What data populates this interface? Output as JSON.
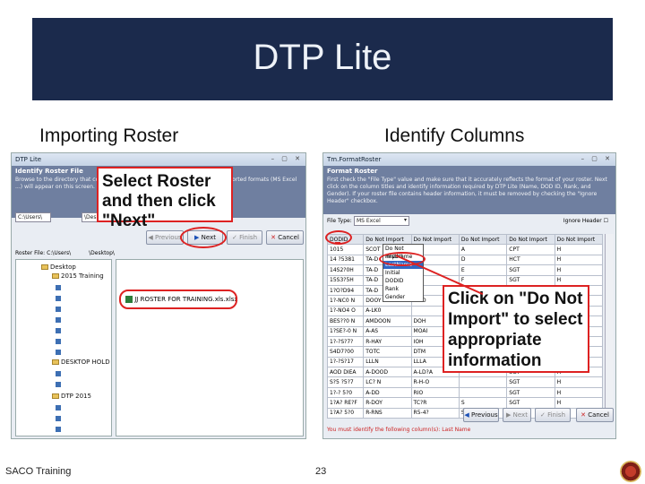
{
  "slide": {
    "title": "DTP Lite",
    "left_heading": "Importing Roster",
    "right_heading": "Identify Columns",
    "footer_left": "SACO Training",
    "page_number": "23"
  },
  "left_window": {
    "window_title": "DTP Lite",
    "pane_title": "Identify Roster File",
    "pane_desc": "Browse to the directory that contains the roster file. Only files in one of the supported formats (MS Excel ...) will appear on this screen.",
    "path_value": "C:\\Users\\",
    "path_value2": "\\Desktop\\",
    "buttons": {
      "previous": "Previous",
      "next": "Next",
      "finish": "Finish",
      "cancel": "Cancel"
    },
    "roster_file_label": "Roster File: C:\\Users\\",
    "roster_file_label2": "\\Desktop\\",
    "tree": {
      "items": [
        "Desktop",
        "2015 Training",
        "DESKTOP HOLD",
        "DTP 2015"
      ]
    },
    "selected_file": "JJ ROSTER FOR TRAINING.xls.xlsx",
    "callout": "Select Roster and then click \"Next\""
  },
  "right_window": {
    "window_title": "Tm.FormatRoster",
    "pane_title": "Format Roster",
    "pane_desc": "First check the \"File Type\" value and make sure that it accurately reflects the format of your roster. Next click on the column titles and identify information required by DTP Lite (Name, DOD ID, Rank, and Gender). If your roster file contains header information, it must be removed by checking the \"Ignore Header\" checkbox.",
    "file_type_label": "File Type:",
    "file_type_value": "MS Excel",
    "ignore_header_label": "Ignore Header",
    "table": {
      "headers": [
        "DODID",
        "Do Not Import",
        "Do Not Import",
        "Do Not Import",
        "Do Not Import",
        "Do Not Import"
      ],
      "rows": [
        [
          "1015",
          "SCOT",
          "",
          "A",
          "CPT",
          "H"
        ],
        [
          "14 ?5381",
          "TA-D",
          "",
          "D",
          "HCT",
          "H"
        ],
        [
          "14S2?0H",
          "TA-D",
          "",
          "E",
          "SGT",
          "H"
        ],
        [
          "15S3?5H",
          "TA-D",
          "",
          "F",
          "SGT",
          "H"
        ],
        [
          "1?O?D94",
          "TA-D",
          "",
          "F",
          "SGT",
          "H"
        ],
        [
          "1?-NC0 N",
          "DOOY",
          "DOO",
          "",
          "SGT",
          "H"
        ],
        [
          "1?-NO4 O",
          "A-LK0",
          "",
          "",
          "SGT",
          "H"
        ],
        [
          "BES??0 N",
          "AMDOON",
          "DOH",
          "",
          "SGT",
          "H"
        ],
        [
          "1?SE?-0 N",
          "A-AS",
          "MOAI",
          "",
          "SGT",
          "H"
        ],
        [
          "1?-?S?7?",
          "R-HAY",
          "IOH",
          "",
          "SGT",
          "H"
        ],
        [
          "S4D7?00",
          "TOTC",
          "DTM",
          "",
          "SGT",
          "H"
        ],
        [
          "1?-?S?17",
          "LLLN",
          "LLLA",
          "",
          "SGT",
          "H"
        ],
        [
          "AOD DIEA",
          "A-DOOD",
          "A-LD?A",
          "",
          "SGT",
          "H"
        ],
        [
          "S?5 ?5?7",
          "LC? N",
          "R-H-O",
          "",
          "SGT",
          "H"
        ],
        [
          "1?-? 5?0",
          "A-DD",
          "RIO",
          "",
          "SGT",
          "H"
        ],
        [
          "1?A? RE?F",
          "R-DOY",
          "TC?R",
          "S",
          "SGT",
          "H"
        ],
        [
          "1?A? 5?0",
          "R-RNS",
          "R5-4?",
          "S",
          "T",
          "H"
        ]
      ]
    },
    "dropdown_options": [
      "Do Not Import",
      "FirstName",
      "LastName",
      "Initial",
      "DODID",
      "Rank",
      "Gender"
    ],
    "dropdown_selected": "LastName",
    "buttons": {
      "previous": "Previous",
      "next": "Next",
      "finish": "Finish",
      "cancel": "Cancel"
    },
    "status_message": "You must identify the following column(s): Last Name",
    "callout": "Click on \"Do Not Import\" to select appropriate information"
  },
  "colors": {
    "title_band": "#1b2a4c",
    "callout_red": "#dd2222",
    "pane_header": "#6f7fa0"
  }
}
